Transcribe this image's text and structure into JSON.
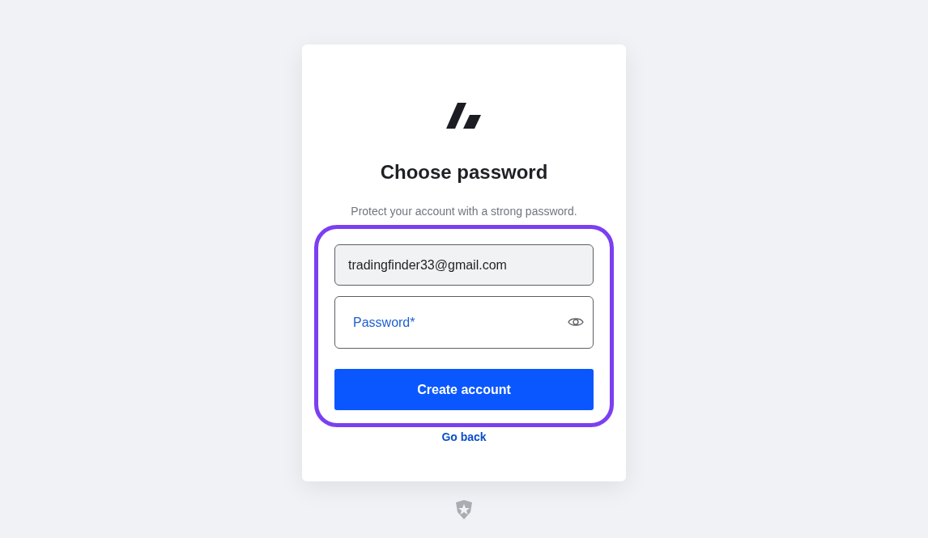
{
  "card": {
    "title": "Choose password",
    "subtitle": "Protect your account with a strong password."
  },
  "email_field": {
    "value": "tradingfinder33@gmail.com"
  },
  "password_field": {
    "placeholder": "Password*"
  },
  "primary_button": {
    "label": "Create account"
  },
  "link": {
    "label": "Go back"
  }
}
